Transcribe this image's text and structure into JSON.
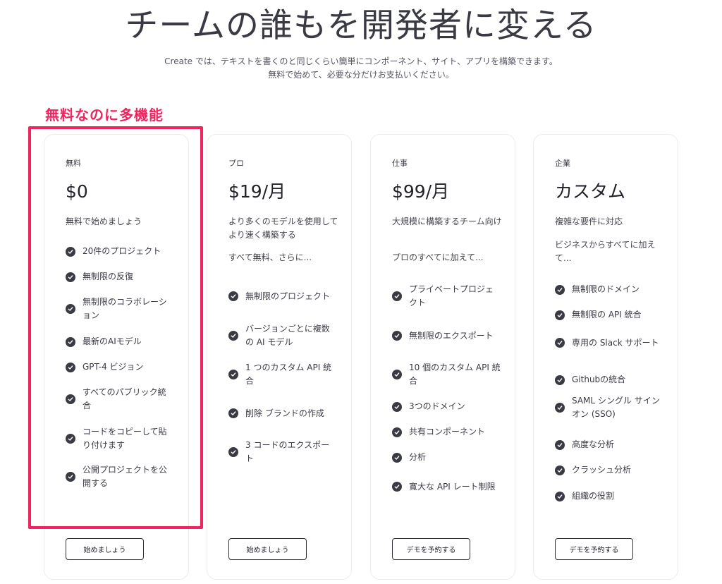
{
  "hero": {
    "title": "チームの誰もを開発者に変える",
    "subtitle_line1": "Create では、テキストを書くのと同じくらい簡単にコンポーネント、サイト、アプリを構築できます。",
    "subtitle_line2": "無料で始めて、必要な分だけお支払いください。"
  },
  "annotation": {
    "label": "無料なのに多機能",
    "color": "#f0245f"
  },
  "plans": [
    {
      "tier": "無料",
      "price": "$0",
      "desc": "無料で始めましょう",
      "intro": "",
      "features": [
        "20件のプロジェクト",
        "無制限の反復",
        "無制限のコラボレーション",
        "最新のAIモデル",
        "GPT-4 ビジョン",
        "すべてのパブリック統合",
        "コードをコピーして貼り付けます",
        "公開プロジェクトを公開する"
      ],
      "button": "始めましょう"
    },
    {
      "tier": "プロ",
      "price": "$19/月",
      "desc": "より多くのモデルを使用してより速く構築する",
      "intro": "すべて無料、さらに...",
      "features": [
        "無制限のプロジェクト",
        "バージョンごとに複数の AI モデル",
        "1 つのカスタム API 統合",
        "削除 ブランドの作成",
        "3 コードのエクスポート"
      ],
      "button": "始めましょう"
    },
    {
      "tier": "仕事",
      "price": "$99/月",
      "desc": "大規模に構築するチーム向け",
      "intro": "プロのすべてに加えて...",
      "features": [
        "プライベートプロジェクト",
        "無制限のエクスポート",
        "10 個のカスタム API 統合",
        "3つのドメイン",
        "共有コンポーネント",
        "分析",
        "寛大な API レート制限"
      ],
      "button": "デモを予約する"
    },
    {
      "tier": "企業",
      "price": "カスタム",
      "desc": "複雑な要件に対応",
      "intro": "ビジネスからすべてに加えて...",
      "features": [
        "無制限のドメイン",
        "無制限の API 統合",
        "専用の Slack サポート",
        "Githubの統合",
        "SAML シングル サインオン (SSO)",
        "高度な分析",
        "クラッシュ分析",
        "組織の役割"
      ],
      "button": "デモを予約する"
    }
  ]
}
